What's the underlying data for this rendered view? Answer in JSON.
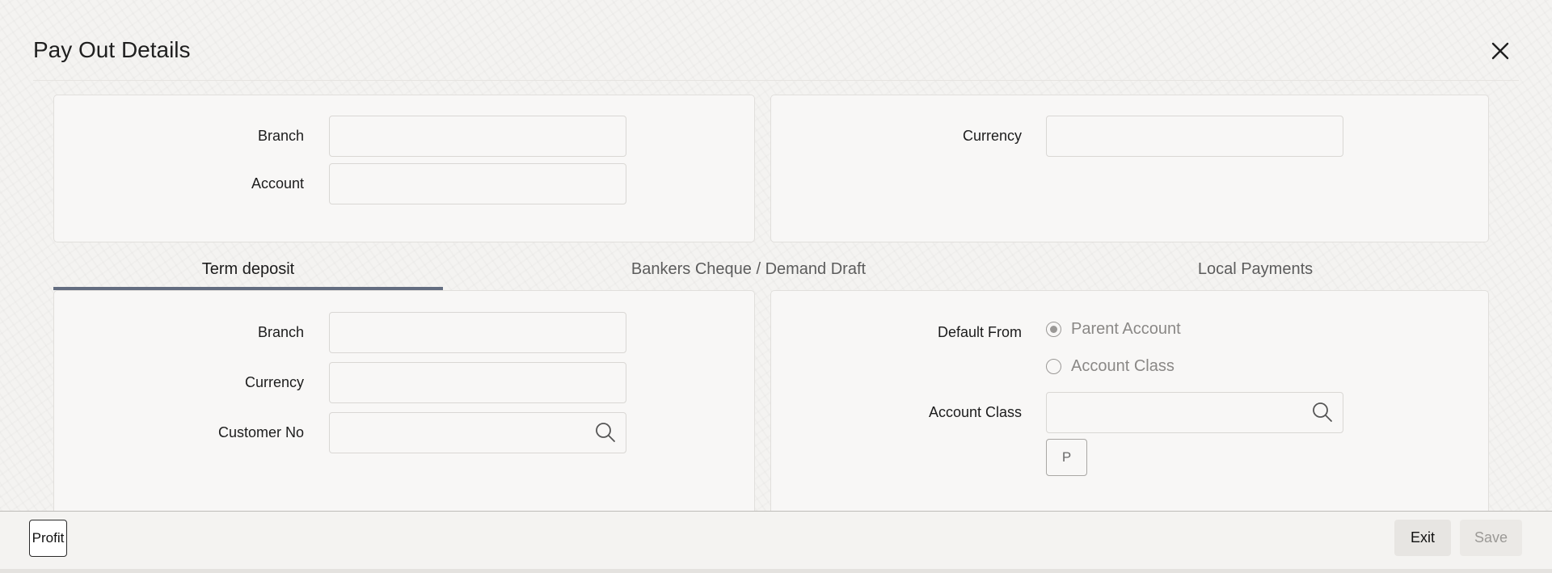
{
  "dialog": {
    "title": "Pay Out Details",
    "close_icon": "close-icon"
  },
  "top_left": {
    "branch_label": "Branch",
    "branch_value": "",
    "account_label": "Account",
    "account_value": ""
  },
  "top_right": {
    "currency_label": "Currency",
    "currency_value": ""
  },
  "tabs": [
    {
      "label": "Term deposit",
      "active": true
    },
    {
      "label": "Bankers Cheque / Demand Draft",
      "active": false
    },
    {
      "label": "Local Payments",
      "active": false
    }
  ],
  "term_deposit": {
    "branch_label": "Branch",
    "branch_value": "",
    "currency_label": "Currency",
    "currency_value": "",
    "customer_no_label": "Customer No",
    "customer_no_value": "",
    "search_icon": "search-icon"
  },
  "defaults": {
    "default_from_label": "Default From",
    "options": [
      {
        "label": "Parent Account",
        "selected": true
      },
      {
        "label": "Account Class",
        "selected": false
      }
    ],
    "account_class_label": "Account Class",
    "account_class_value": "",
    "p_button_label": "P"
  },
  "footer": {
    "profit_label": "Profit",
    "exit_label": "Exit",
    "save_label": "Save"
  },
  "colors": {
    "tab_active_underline": "#636d80",
    "background": "#f4f3f1",
    "panel": "#f8f7f6"
  }
}
